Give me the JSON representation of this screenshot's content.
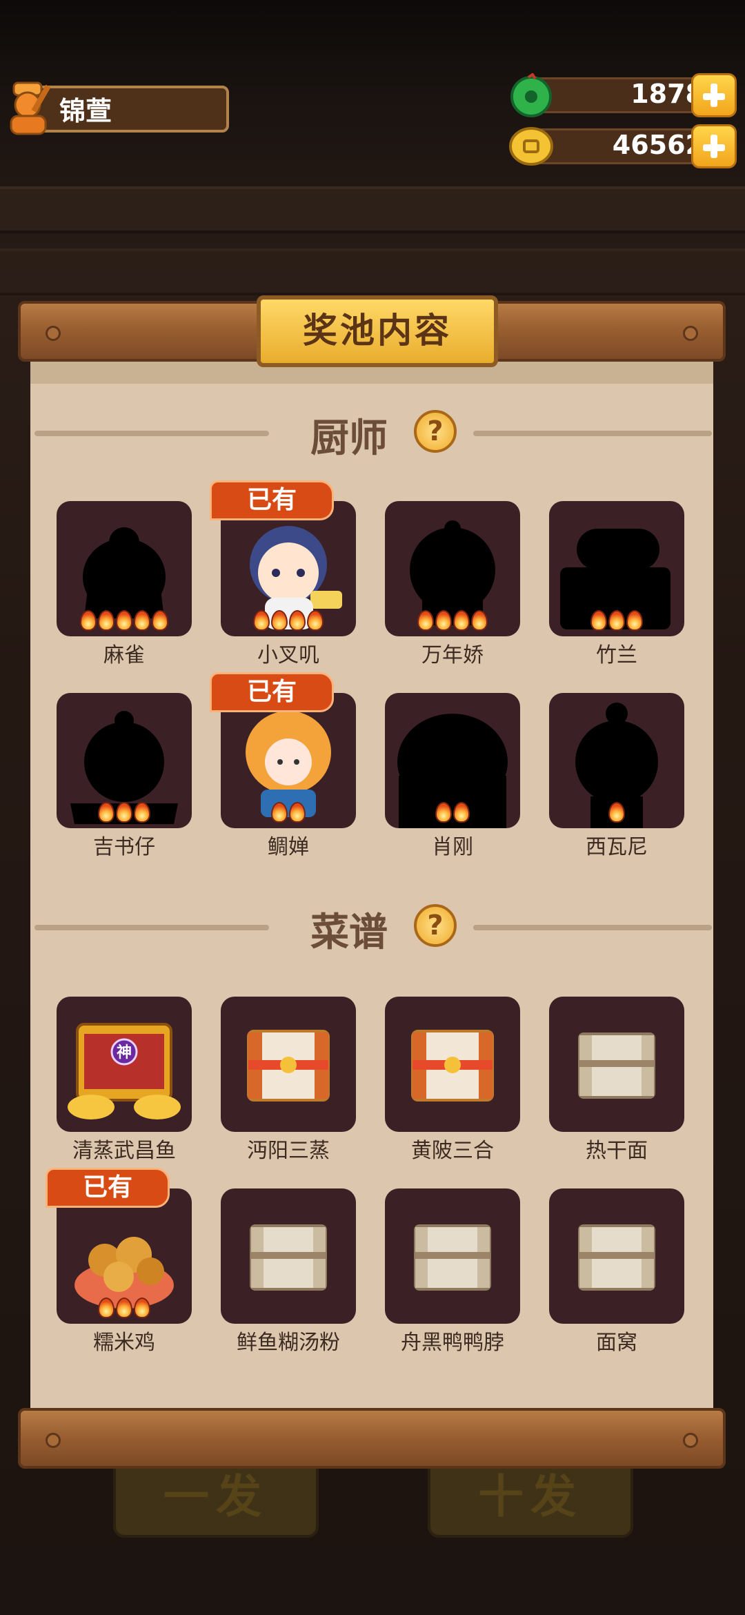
{
  "player": {
    "name": "锦萱"
  },
  "currency": {
    "jade": {
      "value": "1878",
      "icon": "jade-coin-icon"
    },
    "coins": {
      "value": "46562",
      "icon": "gold-coin-icon"
    }
  },
  "background": {
    "button_one": "一发",
    "button_ten": "十发"
  },
  "panel": {
    "title": "奖池内容"
  },
  "chefs": {
    "title": "厨师",
    "items": [
      {
        "name": "麻雀",
        "stars": 5,
        "owned": false
      },
      {
        "name": "小叉叽",
        "stars": 4,
        "owned": true
      },
      {
        "name": "万年娇",
        "stars": 4,
        "owned": false
      },
      {
        "name": "竹兰",
        "stars": 3,
        "owned": false
      },
      {
        "name": "吉书仔",
        "stars": 3,
        "owned": false
      },
      {
        "name": "鲷婵",
        "stars": 2,
        "owned": true
      },
      {
        "name": "肖刚",
        "stars": 2,
        "owned": false
      },
      {
        "name": "西瓦尼",
        "stars": 1,
        "owned": false
      }
    ]
  },
  "recipes": {
    "title": "菜谱",
    "items": [
      {
        "name": "清蒸武昌鱼",
        "stars": 0,
        "owned": false,
        "badge": "神"
      },
      {
        "name": "沔阳三蒸",
        "stars": 0,
        "owned": false
      },
      {
        "name": "黄陂三合",
        "stars": 0,
        "owned": false
      },
      {
        "name": "热干面",
        "stars": 0,
        "owned": false
      },
      {
        "name": "糯米鸡",
        "stars": 3,
        "owned": true
      },
      {
        "name": "鲜鱼糊汤粉",
        "stars": 0,
        "owned": false
      },
      {
        "name": "舟黑鸭鸭脖",
        "stars": 0,
        "owned": false
      },
      {
        "name": "面窝",
        "stars": 0,
        "owned": false
      }
    ]
  },
  "owned_label": "已有",
  "help_label": "?"
}
